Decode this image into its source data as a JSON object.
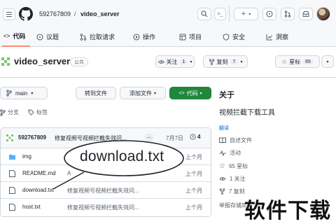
{
  "header": {
    "owner": "592767809",
    "separator": "/",
    "repo": "video_server",
    "plus_label": "+"
  },
  "tabs": [
    {
      "label": "代码"
    },
    {
      "label": "议题"
    },
    {
      "label": "拉取请求"
    },
    {
      "label": "操作"
    },
    {
      "label": "项目"
    },
    {
      "label": "安全"
    },
    {
      "label": "洞察"
    }
  ],
  "repo_head": {
    "name": "video_server",
    "visibility": "公共",
    "watch_label": "关注",
    "watch_count": "1",
    "fork_label": "复刻",
    "fork_count": "7",
    "star_label": "星标",
    "star_count": "65"
  },
  "toolbar": {
    "branch": "main",
    "branches_label": "分支",
    "tags_label": "标签",
    "goto_file": "转到文件",
    "add_file": "添加文件",
    "code_button": "代码"
  },
  "commit": {
    "author": "592767809",
    "message": "修复视频号视频拦截失效问...",
    "more": "...",
    "date": "7月7日",
    "count": "4"
  },
  "files": [
    {
      "name": "img",
      "type": "folder",
      "message": "A",
      "time": "上个月"
    },
    {
      "name": "README.md",
      "type": "file",
      "message": "A",
      "time": "上个月"
    },
    {
      "name": "download.txt",
      "type": "file",
      "message": "修复视频号视频拦截失效问...",
      "time": "上个月"
    },
    {
      "name": "host.txt",
      "type": "file",
      "message": "修复视频号视频拦截失效问...",
      "time": "上个月"
    }
  ],
  "callout": {
    "text": "download.txt"
  },
  "about": {
    "heading": "关于",
    "description": "视频拦截下载工具",
    "translate_link": "翻译",
    "readme": "自述文件",
    "activity": "活动",
    "stars": "65 星标",
    "watching": "1 关注",
    "forks": "7 复刻",
    "report": "举报存储库"
  },
  "overlay": {
    "big_text": "软件下载"
  },
  "colors": {
    "accent_green": "#1f883d",
    "tab_underline": "#fd8c73",
    "link_blue": "#0969da",
    "folder_blue": "#54aeff"
  }
}
